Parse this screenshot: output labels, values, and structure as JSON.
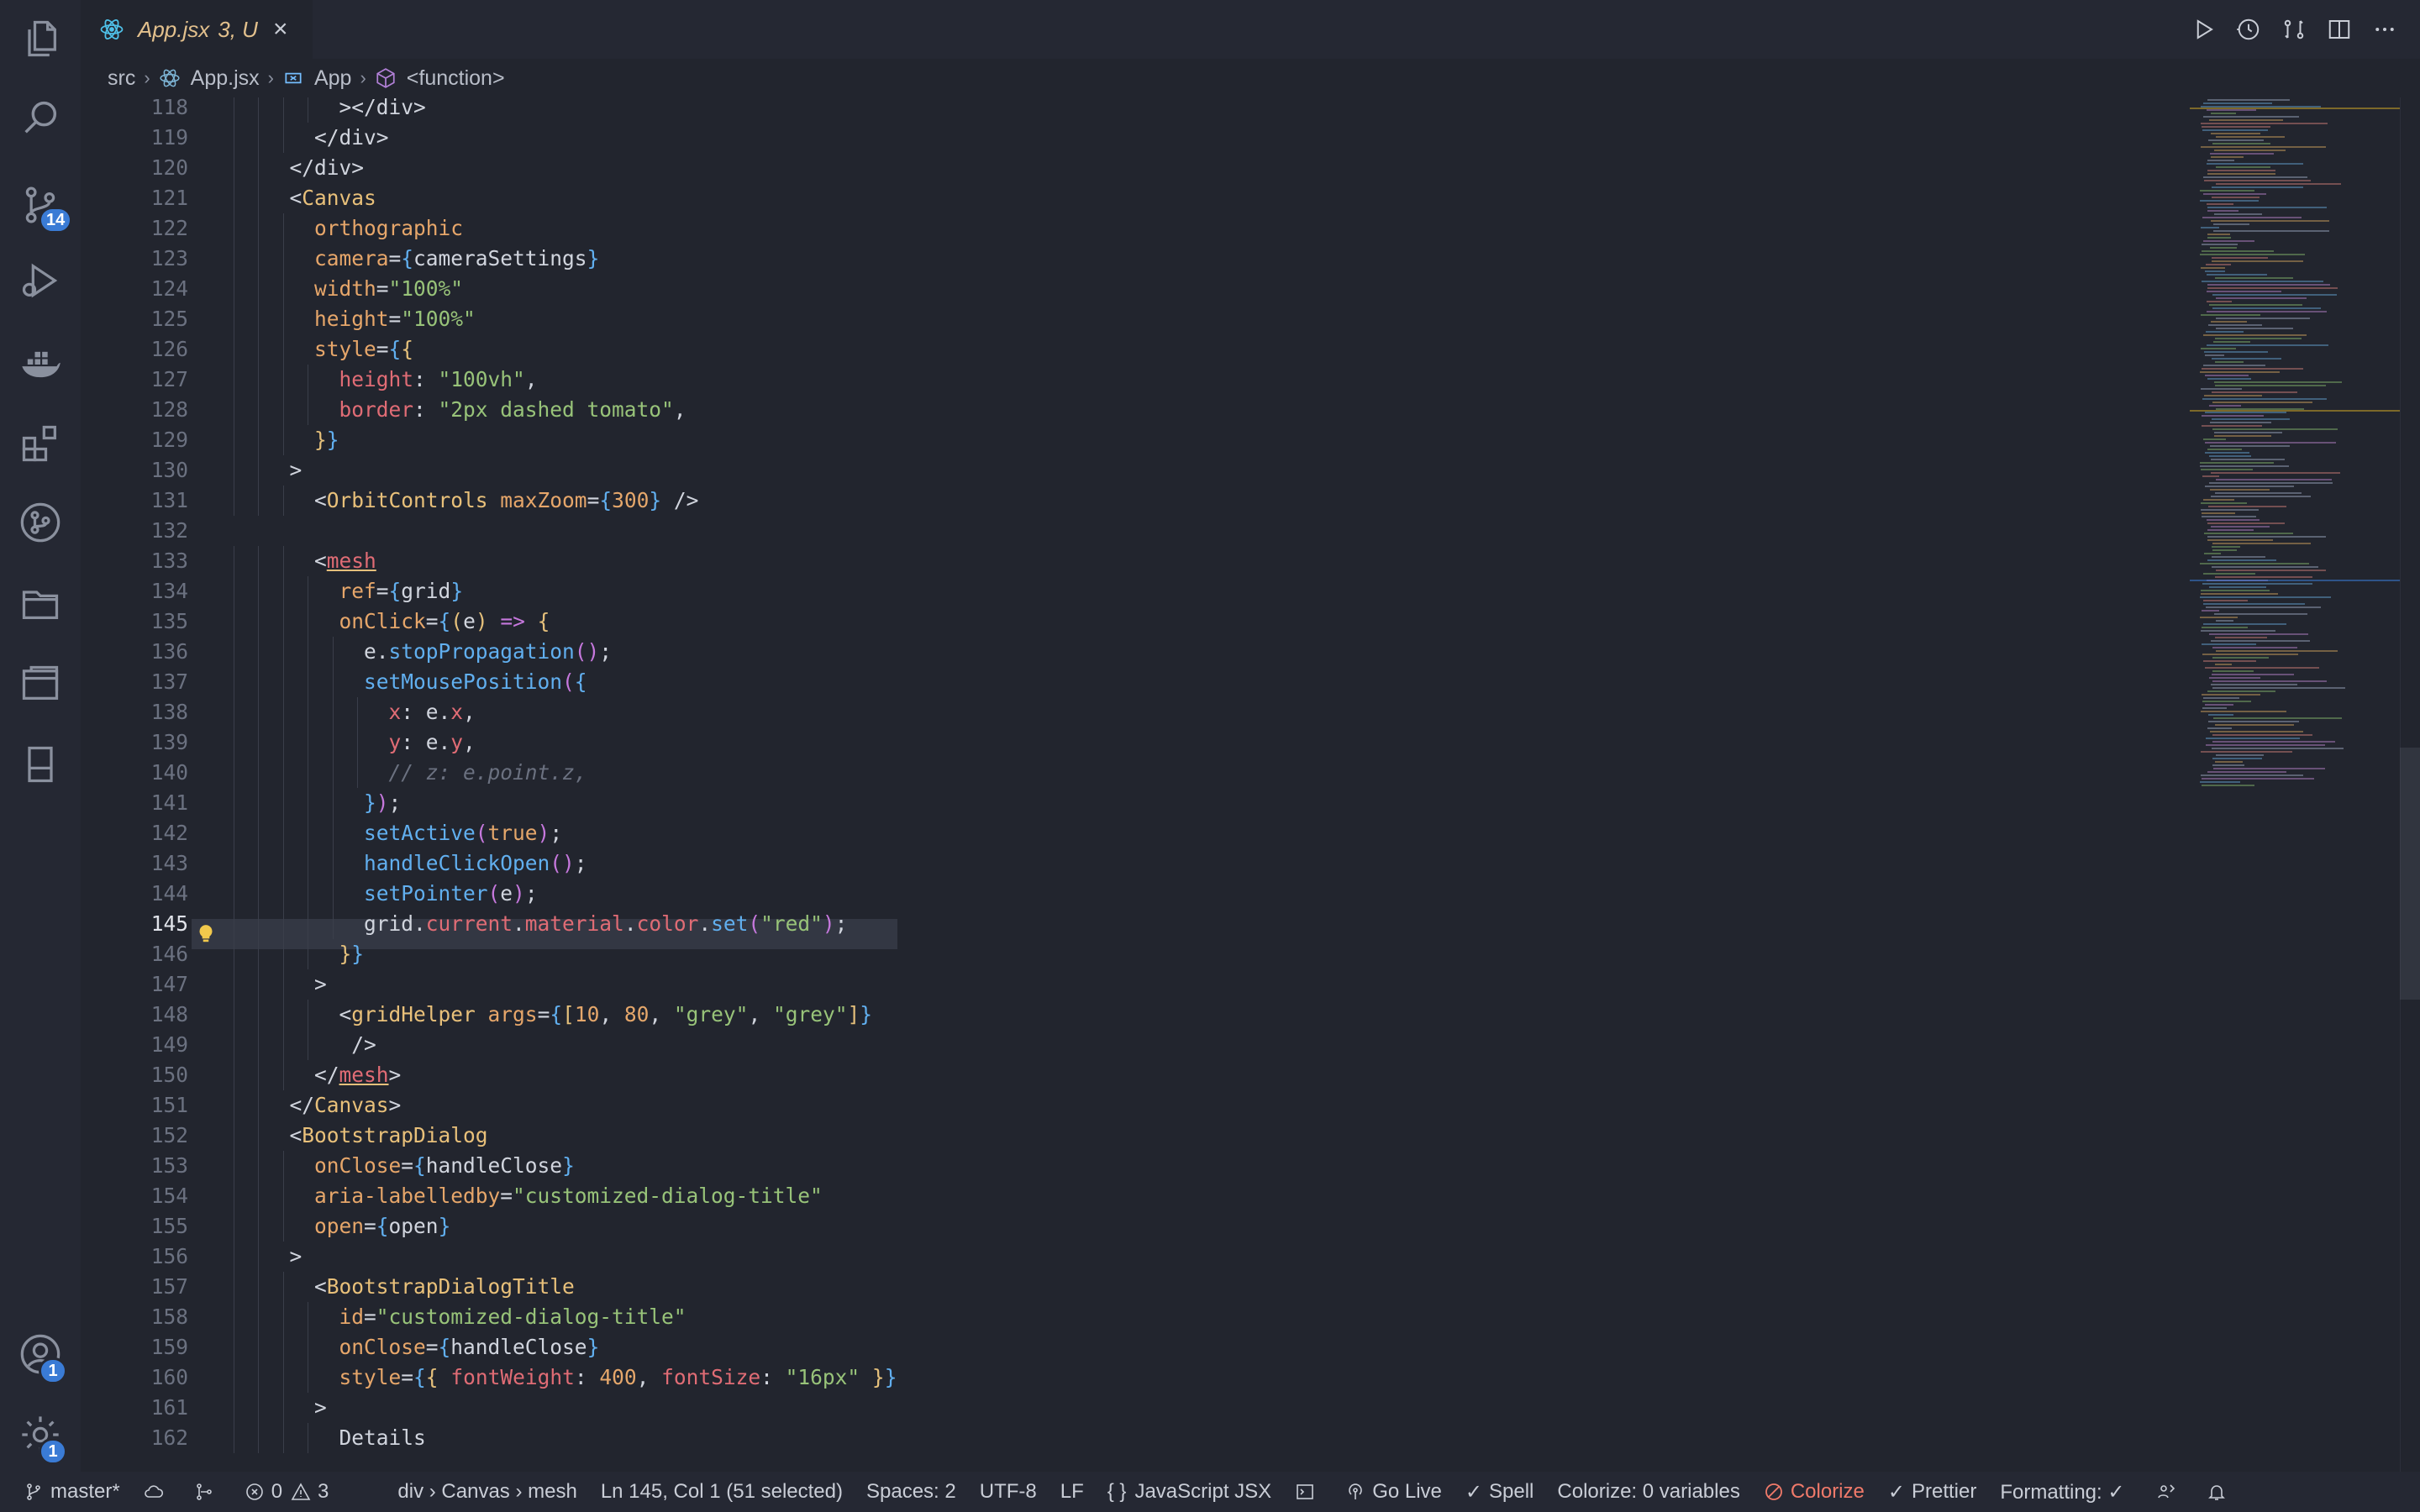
{
  "activity_bar": {
    "items": [
      {
        "icon": "files-icon"
      },
      {
        "icon": "search-icon"
      },
      {
        "icon": "source-control-icon",
        "badge": "14"
      },
      {
        "icon": "run-debug-icon"
      },
      {
        "icon": "docker-icon"
      },
      {
        "icon": "extensions-icon"
      },
      {
        "icon": "git-graph-icon"
      },
      {
        "icon": "project-manager-icon"
      },
      {
        "icon": "remote-explorer-icon"
      },
      {
        "icon": "book-icon"
      }
    ],
    "bottom": [
      {
        "icon": "accounts-icon",
        "badge": "1"
      },
      {
        "icon": "settings-gear-icon",
        "badge": "1"
      }
    ]
  },
  "tab": {
    "name": "App.jsx",
    "status": "3, U",
    "close": "×"
  },
  "editor_actions": [
    "run-icon",
    "timeline-icon",
    "compare-changes-icon",
    "split-editor-icon",
    "more-actions-icon"
  ],
  "breadcrumbs": {
    "folder": "src",
    "file": "App.jsx",
    "symbol": "App",
    "function": "<function>"
  },
  "editor": {
    "current_line": "145",
    "line_numbers": [
      "118",
      "119",
      "120",
      "121",
      "122",
      "123",
      "124",
      "125",
      "126",
      "127",
      "128",
      "129",
      "130",
      "131",
      "132",
      "133",
      "134",
      "135",
      "136",
      "137",
      "138",
      "139",
      "140",
      "141",
      "142",
      "143",
      "144",
      "145",
      "146",
      "147",
      "148",
      "149",
      "150",
      "151",
      "152",
      "153",
      "154",
      "155",
      "156",
      "157",
      "158",
      "159",
      "160",
      "161",
      "162"
    ],
    "code": {
      "l118": "></div>",
      "l119": "</div>",
      "l120": "</div>",
      "l121_tag": "Canvas",
      "l122": "orthographic",
      "l123_attr": "camera",
      "l123_val": "cameraSettings",
      "l124_attr": "width",
      "l124_val": "\"100%\"",
      "l125_attr": "height",
      "l125_val": "\"100%\"",
      "l126_attr": "style",
      "l127_key": "height",
      "l127_val": "\"100vh\"",
      "l128_key": "border",
      "l128_val": "\"2px dashed tomato\"",
      "l131_tag": "OrbitControls",
      "l131_attr": "maxZoom",
      "l131_val": "300",
      "l133_tag": "mesh",
      "l134_attr": "ref",
      "l134_val": "grid",
      "l135_attr": "onClick",
      "l135_param": "e",
      "l136_obj": "e",
      "l136_fn": "stopPropagation",
      "l137_fn": "setMousePosition",
      "l138_key": "x",
      "l138_obj": "e",
      "l138_prop": "x",
      "l139_key": "y",
      "l139_obj": "e",
      "l139_prop": "y",
      "l140_comment": "// z: e.point.z,",
      "l142_fn": "setActive",
      "l142_arg": "true",
      "l143_fn": "handleClickOpen",
      "l144_fn": "setPointer",
      "l144_arg": "e",
      "l145_obj": "grid",
      "l145_p1": "current",
      "l145_p2": "material",
      "l145_p3": "color",
      "l145_fn": "set",
      "l145_arg": "\"red\"",
      "l148_tag": "gridHelper",
      "l148_attr": "args",
      "l148_n1": "10",
      "l148_n2": "80",
      "l148_s1": "\"grey\"",
      "l148_s2": "\"grey\"",
      "l150_tag": "mesh",
      "l151_tag": "Canvas",
      "l152_tag": "BootstrapDialog",
      "l153_attr": "onClose",
      "l153_val": "handleClose",
      "l154_attr": "aria-labelledby",
      "l154_val": "\"customized-dialog-title\"",
      "l155_attr": "open",
      "l155_val": "open",
      "l157_tag": "BootstrapDialogTitle",
      "l158_attr": "id",
      "l158_val": "\"customized-dialog-title\"",
      "l159_attr": "onClose",
      "l159_val": "handleClose",
      "l160_attr": "style",
      "l160_k1": "fontWeight",
      "l160_v1": "400",
      "l160_k2": "fontSize",
      "l160_v2": "\"16px\"",
      "l162_text": "Details"
    }
  },
  "status_bar": {
    "branch": "master*",
    "errors": "0",
    "warnings": "3",
    "path": "div › Canvas › mesh",
    "cursor": "Ln 145, Col 1 (51 selected)",
    "indent": "Spaces: 2",
    "encoding": "UTF-8",
    "eol": "LF",
    "language": "JavaScript JSX",
    "go_live": "Go Live",
    "spell": "Spell",
    "colorize_vars": "Colorize: 0 variables",
    "colorize": "Colorize",
    "prettier": "Prettier",
    "formatting": "Formatting: ✓"
  },
  "colors": {
    "accent_badge": "#3a7bd5",
    "modified_tab": "#e2c08d",
    "colorize_red": "#f07a6a"
  }
}
